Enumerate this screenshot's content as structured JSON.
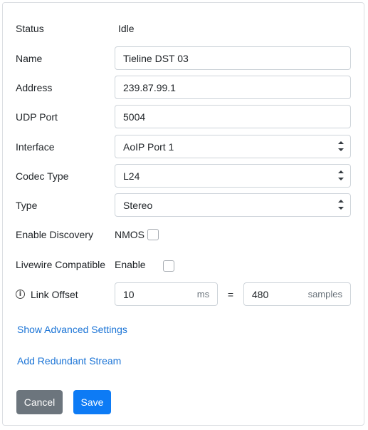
{
  "form": {
    "status": {
      "label": "Status",
      "value": "Idle"
    },
    "name": {
      "label": "Name",
      "value": "Tieline DST 03"
    },
    "address": {
      "label": "Address",
      "value": "239.87.99.1"
    },
    "udp_port": {
      "label": "UDP Port",
      "value": "5004"
    },
    "interface": {
      "label": "Interface",
      "selected": "AoIP Port 1"
    },
    "codec_type": {
      "label": "Codec Type",
      "selected": "L24"
    },
    "type": {
      "label": "Type",
      "selected": "Stereo"
    },
    "enable_discovery": {
      "label": "Enable Discovery",
      "option_label": "NMOS",
      "checked": false
    },
    "livewire_compatible": {
      "label": "Livewire Compatible",
      "option_label": "Enable",
      "checked": false
    },
    "link_offset": {
      "label": "Link Offset",
      "ms_value": "10",
      "ms_unit": "ms",
      "equals": "=",
      "samples_value": "480",
      "samples_unit": "samples"
    }
  },
  "links": {
    "advanced": "Show Advanced Settings",
    "redundant": "Add Redundant Stream"
  },
  "buttons": {
    "cancel": "Cancel",
    "save": "Save"
  },
  "icons": {
    "info": "info-circle-icon",
    "select_arrows": "chevron-up-down-icon"
  },
  "colors": {
    "link": "#1b74d6",
    "cancel_bg": "#6c757d",
    "save_bg": "#0d7bf5"
  }
}
